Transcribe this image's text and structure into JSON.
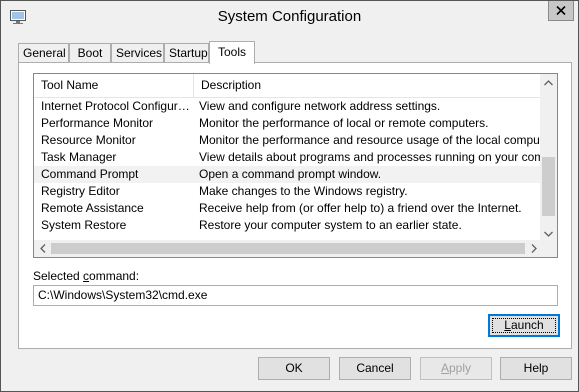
{
  "window": {
    "title": "System Configuration",
    "icon": "system-configuration-icon",
    "close_icon": "close-icon"
  },
  "tabs": [
    {
      "label": "General"
    },
    {
      "label": "Boot"
    },
    {
      "label": "Services"
    },
    {
      "label": "Startup"
    },
    {
      "label": "Tools",
      "active": true
    }
  ],
  "tools_list": {
    "columns": [
      "Tool Name",
      "Description"
    ],
    "rows": [
      {
        "name": "Internet Protocol Configurat...",
        "description": "View and configure network address settings."
      },
      {
        "name": "Performance Monitor",
        "description": "Monitor the performance of local or remote computers."
      },
      {
        "name": "Resource Monitor",
        "description": "Monitor the performance and resource usage of the local computer."
      },
      {
        "name": "Task Manager",
        "description": "View details about programs and processes running on your computer."
      },
      {
        "name": "Command Prompt",
        "description": "Open a command prompt window.",
        "selected": true
      },
      {
        "name": "Registry Editor",
        "description": "Make changes to the Windows registry."
      },
      {
        "name": "Remote Assistance",
        "description": "Receive help from (or offer help to) a friend over the Internet."
      },
      {
        "name": "System Restore",
        "description": "Restore your computer system to an earlier state."
      }
    ]
  },
  "selected_command": {
    "label_prefix": "Selected ",
    "label_accel": "c",
    "label_suffix": "ommand:",
    "value": "C:\\Windows\\System32\\cmd.exe"
  },
  "launch": {
    "accel": "L",
    "rest": "aunch"
  },
  "footer": {
    "ok": "OK",
    "cancel": "Cancel",
    "apply_accel": "A",
    "apply_rest": "pply",
    "help": "Help"
  },
  "colors": {
    "focus_border": "#0078d7",
    "selected_row": "#f2f2f2",
    "window_bg": "#f0f0f0"
  }
}
